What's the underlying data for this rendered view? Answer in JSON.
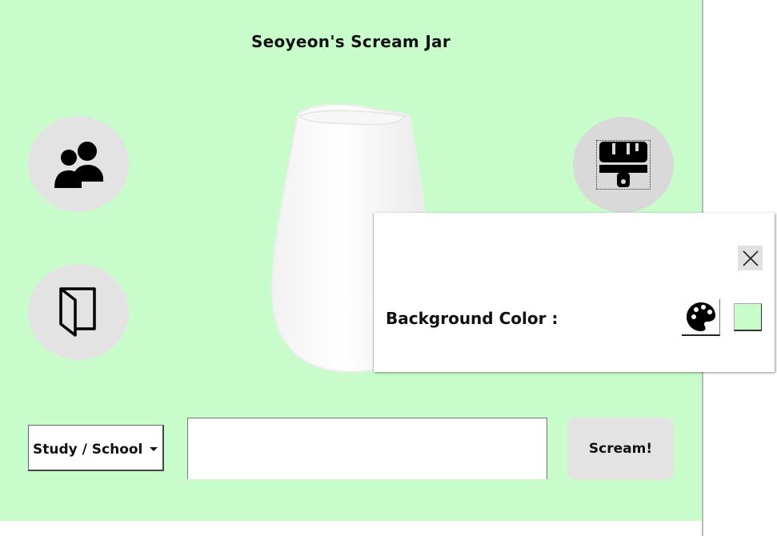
{
  "app": {
    "title": "Seoyeon's Scream Jar",
    "background_color": "#c8fdcb"
  },
  "buttons": {
    "users_icon": "users-icon",
    "exit_icon": "door-exit-icon",
    "paint_icon": "paint-brush-icon",
    "scream_label": "Scream!"
  },
  "category": {
    "selected": "Study / School"
  },
  "scream_input": {
    "value": ""
  },
  "color_panel": {
    "label": "Background Color :",
    "close_icon": "close-icon",
    "palette_icon": "palette-icon",
    "current_color": "#c8fdcb"
  }
}
